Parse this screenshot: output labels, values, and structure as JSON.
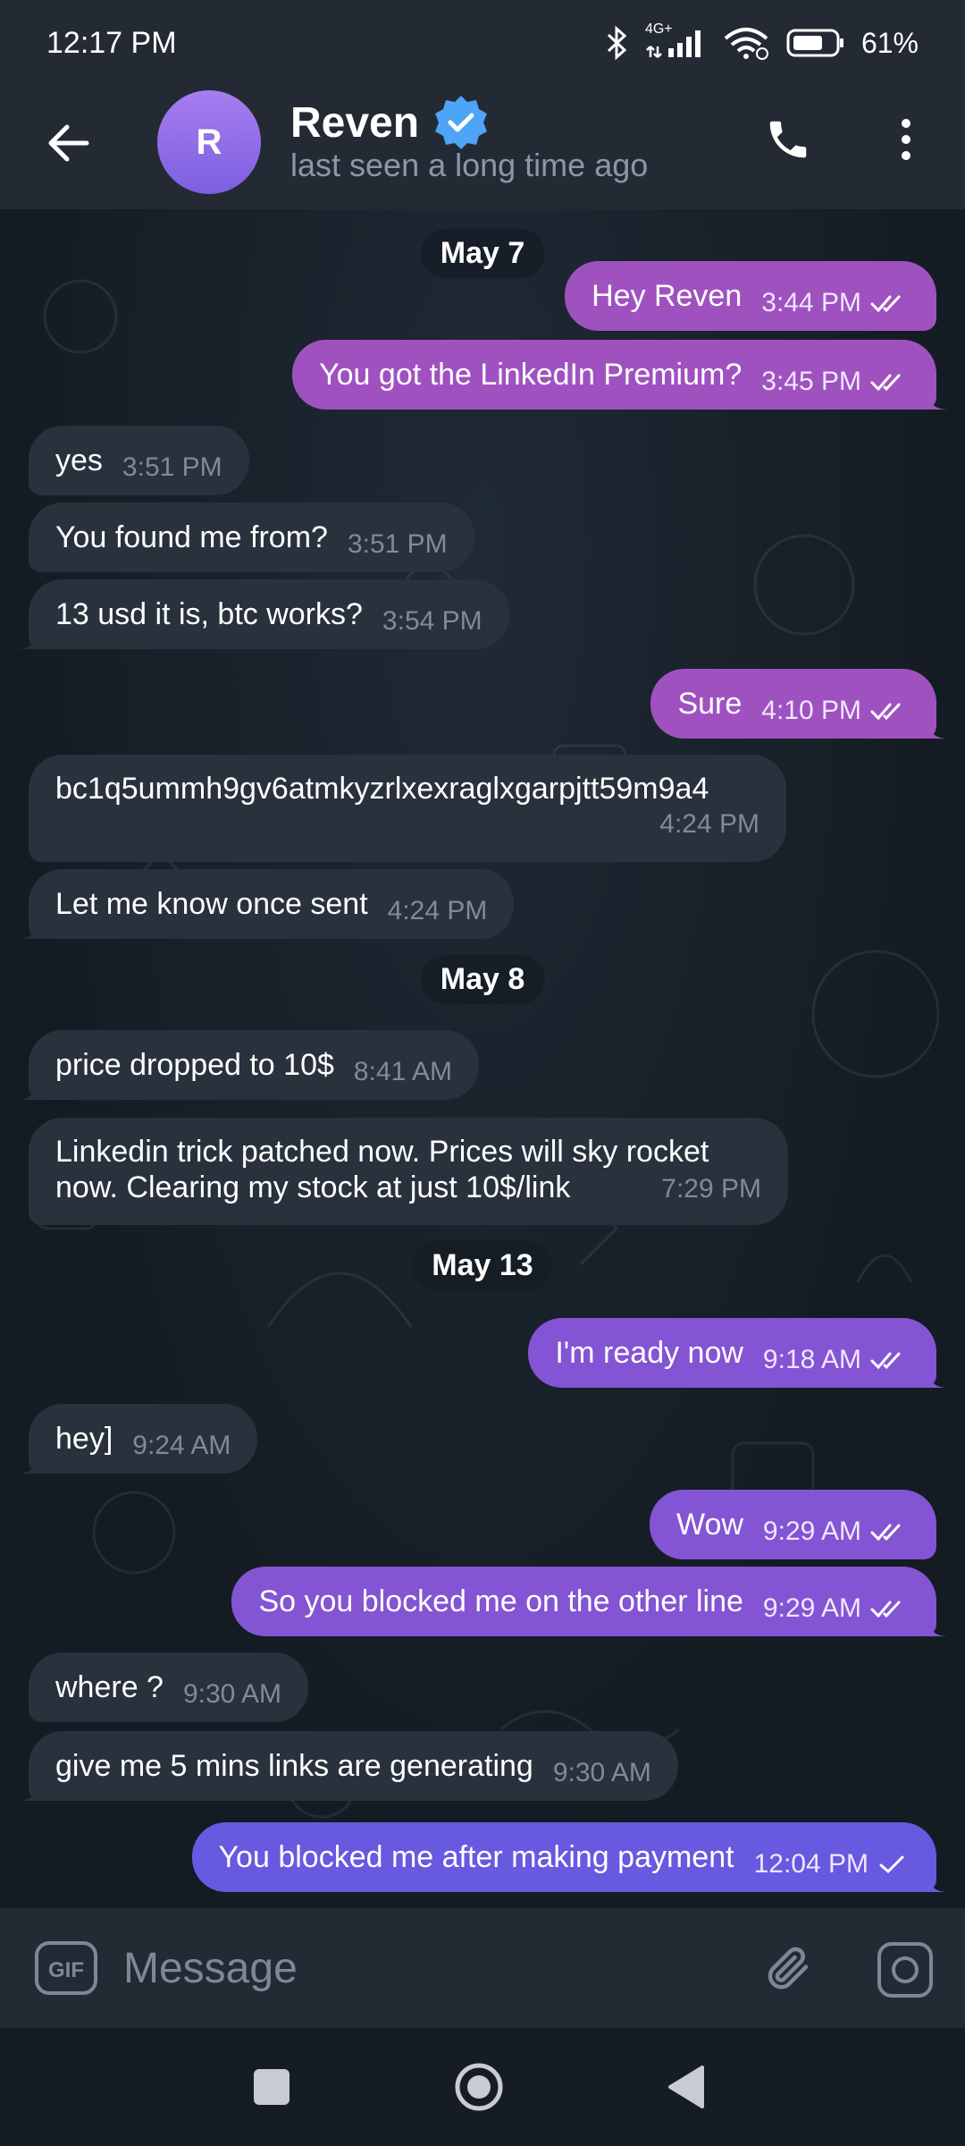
{
  "status_bar": {
    "time": "12:17 PM",
    "network": "4G+",
    "battery": "61%"
  },
  "header": {
    "avatar_letter": "R",
    "name": "Reven",
    "last_seen": "last seen a long time ago"
  },
  "dates": [
    "May 7",
    "May 8",
    "May 13"
  ],
  "messages": [
    {
      "dir": "out",
      "text": "Hey Reven",
      "time": "3:44 PM",
      "status": "read"
    },
    {
      "dir": "out",
      "text": "You got the LinkedIn Premium?",
      "time": "3:45 PM",
      "status": "read"
    },
    {
      "dir": "in",
      "text": "yes",
      "time": "3:51 PM"
    },
    {
      "dir": "in",
      "text": "You found me from?",
      "time": "3:51 PM"
    },
    {
      "dir": "in",
      "text": "13 usd it is, btc works?",
      "time": "3:54 PM"
    },
    {
      "dir": "out",
      "text": "Sure",
      "time": "4:10 PM",
      "status": "read"
    },
    {
      "dir": "in",
      "text": "bc1q5ummh9gv6atmkyzrlxexraglxgarpjtt59m9a4",
      "time": "4:24 PM"
    },
    {
      "dir": "in",
      "text": "Let me know once sent",
      "time": "4:24 PM"
    },
    {
      "dir": "in",
      "text": "price dropped to 10$",
      "time": "8:41 AM"
    },
    {
      "dir": "in",
      "text": "Linkedin trick patched now. Prices will sky rocket now. Clearing my stock at just 10$/link",
      "time": "7:29 PM"
    },
    {
      "dir": "out",
      "text": "I'm ready now",
      "time": "9:18 AM",
      "status": "read"
    },
    {
      "dir": "in",
      "text": "hey]",
      "time": "9:24 AM"
    },
    {
      "dir": "out",
      "text": "Wow",
      "time": "9:29 AM",
      "status": "read"
    },
    {
      "dir": "out",
      "text": "So you blocked me on the other line",
      "time": "9:29 AM",
      "status": "read"
    },
    {
      "dir": "in",
      "text": "where ?",
      "time": "9:30 AM"
    },
    {
      "dir": "in",
      "text": "give me 5 mins links are generating",
      "time": "9:30 AM"
    },
    {
      "dir": "out",
      "text": "You blocked me after making payment",
      "time": "12:04 PM",
      "status": "sent"
    }
  ],
  "composer": {
    "placeholder": "Message",
    "gif_label": "GIF"
  },
  "icons": {
    "back": "arrow-left-icon",
    "verified": "verified-badge-icon",
    "call": "phone-icon",
    "menu": "more-vertical-icon",
    "read": "double-check-icon",
    "sent": "single-check-icon",
    "attach": "paperclip-icon",
    "camera": "camera-icon"
  },
  "colors": {
    "accent_blue": "#4ea4f6",
    "outgoing_pink": "#9f52bf",
    "outgoing_purple": "#8354d3",
    "outgoing_indigo": "#6759e0",
    "incoming": "#28313c"
  }
}
